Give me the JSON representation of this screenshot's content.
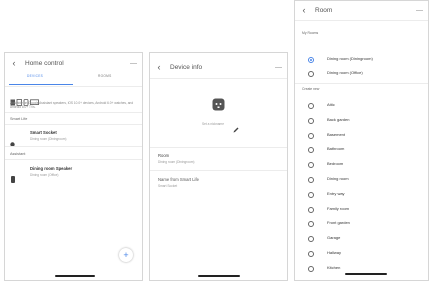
{
  "home": {
    "title": "Home control",
    "menu": "—",
    "tabs": [
      "DEVICES",
      "ROOMS"
    ],
    "note": "Available on Google Assistant speakers, iOS 10.0+ devices, Android 6.0+ watches, and Android 8.0+ TVs.",
    "section_smart_life": "Smart Life",
    "smart_socket_title": "Smart Socket",
    "smart_socket_sub": "Dining room (Diningroom)",
    "section_assistant": "Assistant",
    "speaker_title": "Dining room Speaker",
    "speaker_sub": "Dining room (Office)",
    "fab": "+"
  },
  "device_info": {
    "title": "Device info",
    "menu": "—",
    "nickname_placeholder": "Set a nickname",
    "room_label": "Room",
    "room_value": "Dining room (Diningroom)",
    "name_label": "Name from Smart Life",
    "name_value": "Smart Socket"
  },
  "room": {
    "title": "Room",
    "menu": "—",
    "my_rooms_label": "My Rooms",
    "my_rooms": [
      {
        "label": "Dining room (Diningroom)",
        "selected": true
      },
      {
        "label": "Dining room (Office)",
        "selected": false
      }
    ],
    "create_new_label": "Create new",
    "create_new": [
      "Attic",
      "Back garden",
      "Basement",
      "Bathroom",
      "Bedroom",
      "Dining room",
      "Entry way",
      "Family room",
      "Front garden",
      "Garage",
      "Hallway",
      "Kitchen"
    ]
  },
  "colors": {
    "accent": "#4a86e8",
    "text": "#333333",
    "muted": "#888888"
  }
}
